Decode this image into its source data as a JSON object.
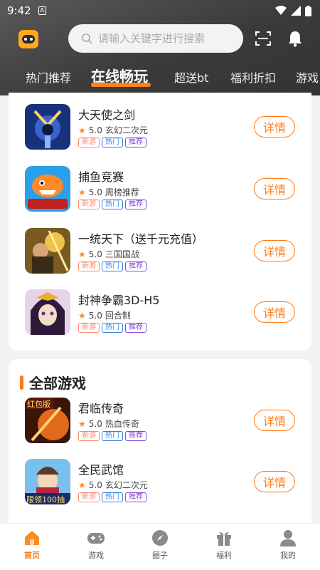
{
  "status": {
    "time": "9:42"
  },
  "search": {
    "placeholder": "请输入关键字进行搜索"
  },
  "tabs": [
    {
      "label": "热门推荐"
    },
    {
      "label": "在线畅玩"
    },
    {
      "label": "超送bt"
    },
    {
      "label": "福利折扣"
    },
    {
      "label": "游戏"
    }
  ],
  "online_games": [
    {
      "name": "大天使之剑",
      "rating": "5.0",
      "category": "玄幻二次元",
      "tags": [
        "新游",
        "热门",
        "推荐"
      ],
      "button": "详情",
      "icon": "sword-warrior-icon"
    },
    {
      "name": "捕鱼竞赛",
      "rating": "5.0",
      "category": "周榜推荐",
      "tags": [
        "新游",
        "热门",
        "推荐"
      ],
      "button": "详情",
      "icon": "fish-game-icon"
    },
    {
      "name": "一统天下（送千元充值）",
      "rating": "5.0",
      "category": "三国国战",
      "tags": [
        "新游",
        "热门",
        "推荐"
      ],
      "button": "详情",
      "icon": "general-icon"
    },
    {
      "name": "封神争霸3D-H5",
      "rating": "5.0",
      "category": "回合制",
      "tags": [
        "新游",
        "热门",
        "推荐"
      ],
      "button": "详情",
      "icon": "goddess-icon"
    }
  ],
  "all_games_section": {
    "title": "全部游戏"
  },
  "all_games": [
    {
      "name": "君临传奇",
      "rating": "5.0",
      "category": "热血传奇",
      "tags": [
        "新游",
        "热门",
        "推荐"
      ],
      "button": "详情",
      "icon": "legend-icon",
      "icon_text": "红包版"
    },
    {
      "name": "全民武馆",
      "rating": "5.0",
      "category": "玄幻二次元",
      "tags": [
        "新游",
        "热门",
        "推荐"
      ],
      "button": "详情",
      "icon": "martial-icon",
      "icon_text": "限领100抽"
    }
  ],
  "bottom_nav": [
    {
      "label": "首页",
      "icon": "home-icon"
    },
    {
      "label": "游戏",
      "icon": "gamepad-icon"
    },
    {
      "label": "圈子",
      "icon": "compass-icon"
    },
    {
      "label": "福利",
      "icon": "gift-icon"
    },
    {
      "label": "我的",
      "icon": "user-icon"
    }
  ],
  "colors": {
    "accent": "#ff7a16",
    "header_bg": "#4a4a4a",
    "tag_new": "#ff8a6b",
    "tag_hot": "#2f7de8",
    "tag_rec": "#8a46d8"
  }
}
